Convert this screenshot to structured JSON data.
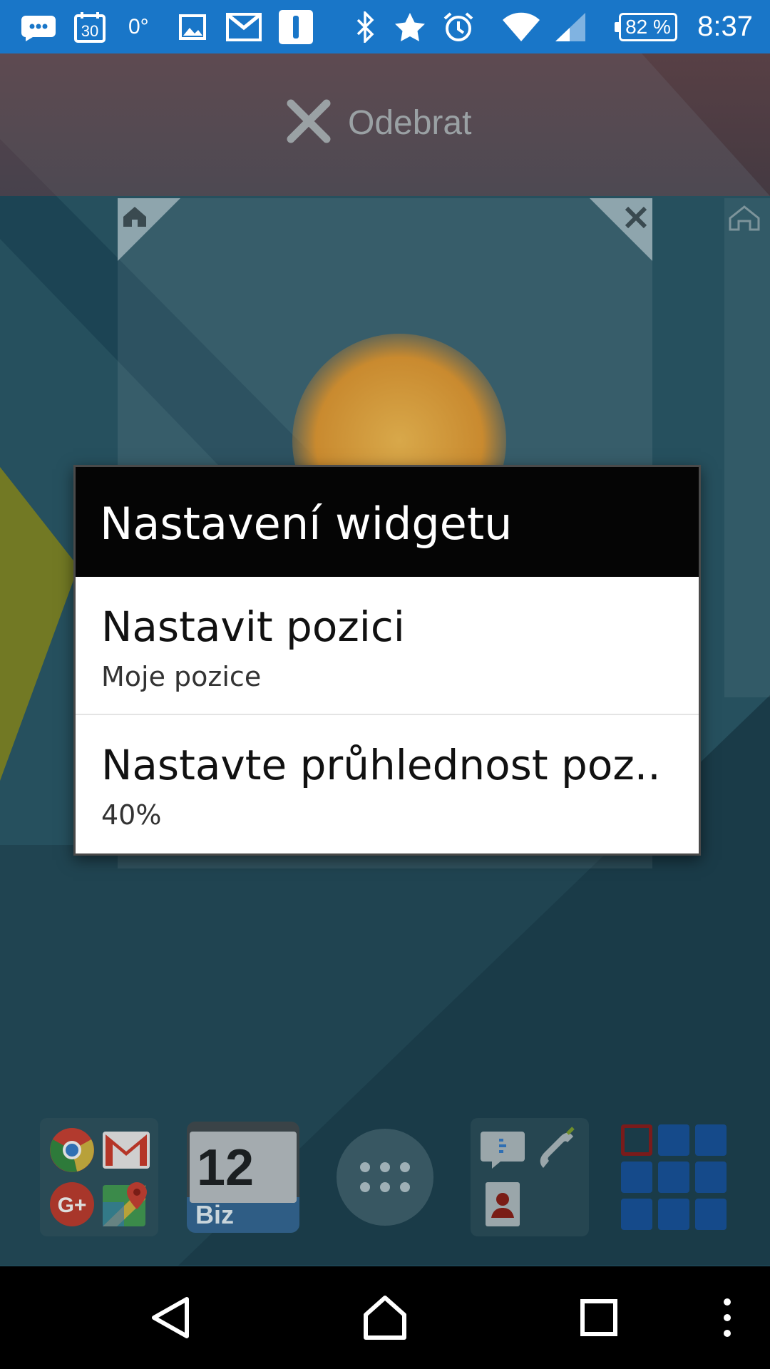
{
  "status_bar": {
    "temperature": "0°",
    "calendar_day": "30",
    "battery": "82 %",
    "time": "8:37",
    "icons": [
      "chat-icon",
      "calendar-icon",
      "temperature",
      "image-icon",
      "gmail-icon",
      "app-icon",
      "bluetooth-icon",
      "star-icon",
      "alarm-icon",
      "wifi-icon",
      "signal-icon",
      "battery-icon"
    ]
  },
  "remove_bar": {
    "label": "Odebrat",
    "icon": "close-icon"
  },
  "widget": {
    "corner_left_icon": "home-icon",
    "corner_right_icon": "close-icon"
  },
  "dialog": {
    "title": "Nastavení widgetu",
    "items": [
      {
        "title": "Nastavit pozici",
        "subtitle": "Moje pozice"
      },
      {
        "title": "Nastavte průhlednost poz..",
        "subtitle": "40%"
      }
    ]
  },
  "dock": {
    "items": [
      {
        "name": "google-apps-folder",
        "icons": [
          "chrome-icon",
          "gmail-icon",
          "google-plus-icon",
          "maps-icon"
        ]
      },
      {
        "name": "calendar-app",
        "number": "12",
        "label": "Biz"
      },
      {
        "name": "app-drawer-button"
      },
      {
        "name": "communication-folder",
        "icons": [
          "messaging-icon",
          "phone-icon",
          "contacts-icon"
        ]
      },
      {
        "name": "tiles-app"
      }
    ]
  },
  "nav_bar": {
    "icons": [
      "back-icon",
      "home-icon",
      "recents-icon",
      "menu-icon"
    ]
  },
  "colors": {
    "status_bar": "#1976c8",
    "dialog_title_bg": "#050505",
    "nav_bg": "#000000"
  }
}
